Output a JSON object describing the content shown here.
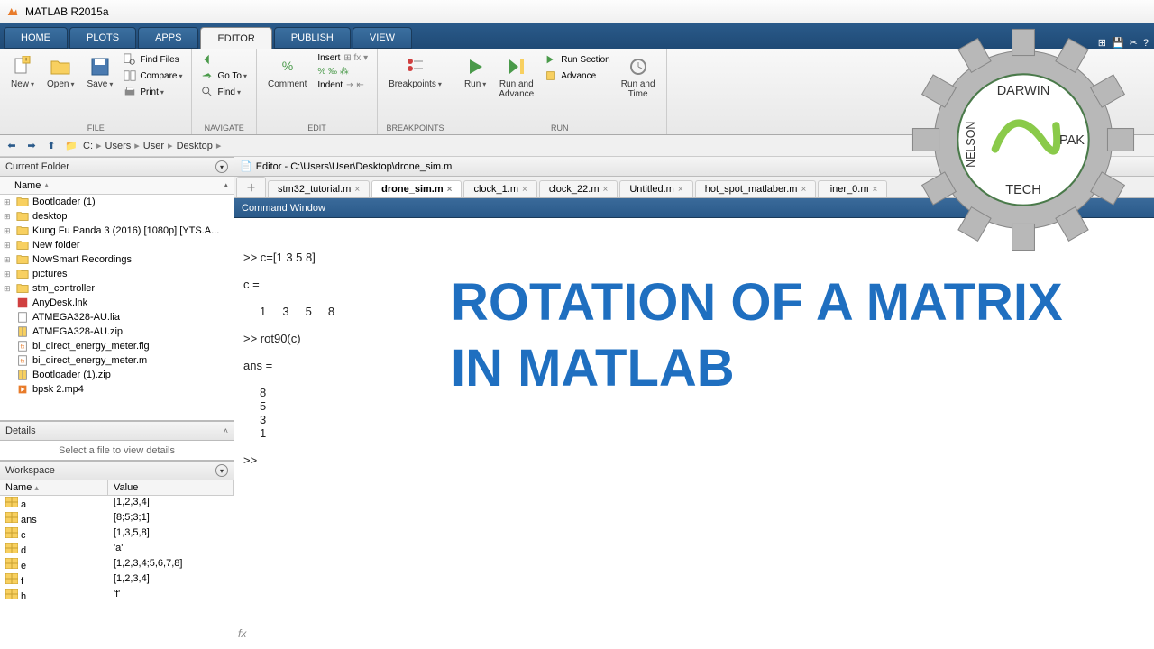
{
  "title": "MATLAB R2015a",
  "tabs": [
    "HOME",
    "PLOTS",
    "APPS",
    "EDITOR",
    "PUBLISH",
    "VIEW"
  ],
  "activeTab": 3,
  "ribbon": {
    "file": {
      "label": "FILE",
      "new": "New",
      "open": "Open",
      "save": "Save",
      "findFiles": "Find Files",
      "compare": "Compare",
      "print": "Print"
    },
    "navigate": {
      "label": "NAVIGATE",
      "goto": "Go To",
      "find": "Find"
    },
    "edit": {
      "label": "EDIT",
      "comment": "Comment",
      "insert": "Insert",
      "indent": "Indent"
    },
    "breakpoints": {
      "label": "BREAKPOINTS",
      "btn": "Breakpoints"
    },
    "run": {
      "label": "RUN",
      "run": "Run",
      "runAdvance": "Run and\nAdvance",
      "runSection": "Run Section",
      "advance": "Advance",
      "runTime": "Run and\nTime"
    }
  },
  "breadcrumb": [
    "C:",
    "Users",
    "User",
    "Desktop"
  ],
  "currentFolder": {
    "title": "Current Folder",
    "nameCol": "Name",
    "items": [
      {
        "name": "Bootloader (1)",
        "type": "folder"
      },
      {
        "name": "desktop",
        "type": "folder"
      },
      {
        "name": "Kung Fu Panda 3 (2016) [1080p] [YTS.A...",
        "type": "folder"
      },
      {
        "name": "New folder",
        "type": "folder"
      },
      {
        "name": "NowSmart Recordings",
        "type": "folder"
      },
      {
        "name": "pictures",
        "type": "folder"
      },
      {
        "name": "stm_controller",
        "type": "folder"
      },
      {
        "name": "AnyDesk.lnk",
        "type": "lnk"
      },
      {
        "name": "ATMEGA328-AU.lia",
        "type": "file"
      },
      {
        "name": "ATMEGA328-AU.zip",
        "type": "zip"
      },
      {
        "name": "bi_direct_energy_meter.fig",
        "type": "fig"
      },
      {
        "name": "bi_direct_energy_meter.m",
        "type": "m"
      },
      {
        "name": "Bootloader (1).zip",
        "type": "zip"
      },
      {
        "name": "bpsk 2.mp4",
        "type": "mp4"
      }
    ]
  },
  "details": {
    "title": "Details",
    "placeholder": "Select a file to view details"
  },
  "workspace": {
    "title": "Workspace",
    "nameCol": "Name",
    "valCol": "Value",
    "vars": [
      {
        "name": "a",
        "value": "[1,2,3,4]"
      },
      {
        "name": "ans",
        "value": "[8;5;3;1]"
      },
      {
        "name": "c",
        "value": "[1,3,5,8]"
      },
      {
        "name": "d",
        "value": "'a'"
      },
      {
        "name": "e",
        "value": "[1,2,3,4;5,6,7,8]"
      },
      {
        "name": "f",
        "value": "[1,2,3,4]"
      },
      {
        "name": "h",
        "value": "'f'"
      }
    ]
  },
  "editor": {
    "title": "Editor - C:\\Users\\User\\Desktop\\drone_sim.m",
    "tabs": [
      "stm32_tutorial.m",
      "drone_sim.m",
      "clock_1.m",
      "clock_22.m",
      "Untitled.m",
      "hot_spot_matlaber.m",
      "liner_0.m"
    ],
    "active": 1
  },
  "commandWindow": {
    "title": "Command Window",
    "lines": [
      ">> c=[1 3 5 8]",
      "",
      "c =",
      "",
      "     1     3     5     8",
      "",
      ">> rot90(c)",
      "",
      "ans =",
      "",
      "     8",
      "     5",
      "     3",
      "     1",
      "",
      ">> "
    ]
  },
  "overlay": {
    "line1": "ROTATION OF A MATRIX",
    "line2": "IN MATLAB"
  },
  "logo": {
    "text1": "DARWIN",
    "text2": "PAK",
    "text3": "NELSON",
    "text4": "TECH"
  }
}
